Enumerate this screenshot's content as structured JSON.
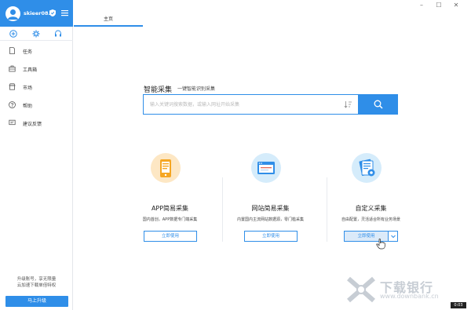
{
  "user": {
    "name": "skieer08..."
  },
  "nav": [
    {
      "label": "任务"
    },
    {
      "label": "工具箱"
    },
    {
      "label": "市场"
    },
    {
      "label": "帮助"
    },
    {
      "label": "建议反馈"
    }
  ],
  "upgrade": {
    "line1": "升级账号，享无限量",
    "line2": "云加速下载单倍特权",
    "button": "马上升级"
  },
  "tabs": {
    "home": "主页"
  },
  "smart": {
    "title": "智能采集",
    "subtitle": "一键智能识别采集",
    "placeholder": "输入关键词搜索数据，或输入网址开始采集"
  },
  "cards": [
    {
      "title": "APP简易采集",
      "desc": "国内首创，APP数据专门端采集",
      "button": "立即使用"
    },
    {
      "title": "网站简易采集",
      "desc": "内置国内主流网站数据源，零门槛采集",
      "button": "立即使用"
    },
    {
      "title": "自定义采集",
      "desc": "自由配置，灵活适合所有业务场景",
      "button": "立即使用"
    }
  ],
  "watermark": {
    "brand": "下载银行",
    "url": "www.downbank.cn",
    "badge": "0:03"
  },
  "colors": {
    "accent": "#2f8ee8",
    "app_circle": "#fde7c4",
    "web_circle": "#d5ecfb",
    "custom_circle": "#d5ecfb"
  },
  "icons": [
    "user-avatar-icon",
    "shield-icon",
    "menu-icon",
    "add-circle-icon",
    "settings-gear-icon",
    "headset-icon",
    "document-icon",
    "toolbox-icon",
    "market-icon",
    "help-icon",
    "feedback-icon",
    "sort-icon",
    "search-icon",
    "app-phone-icon",
    "web-browser-icon",
    "custom-gear-doc-icon",
    "chevron-down-icon",
    "hand-cursor-icon"
  ]
}
